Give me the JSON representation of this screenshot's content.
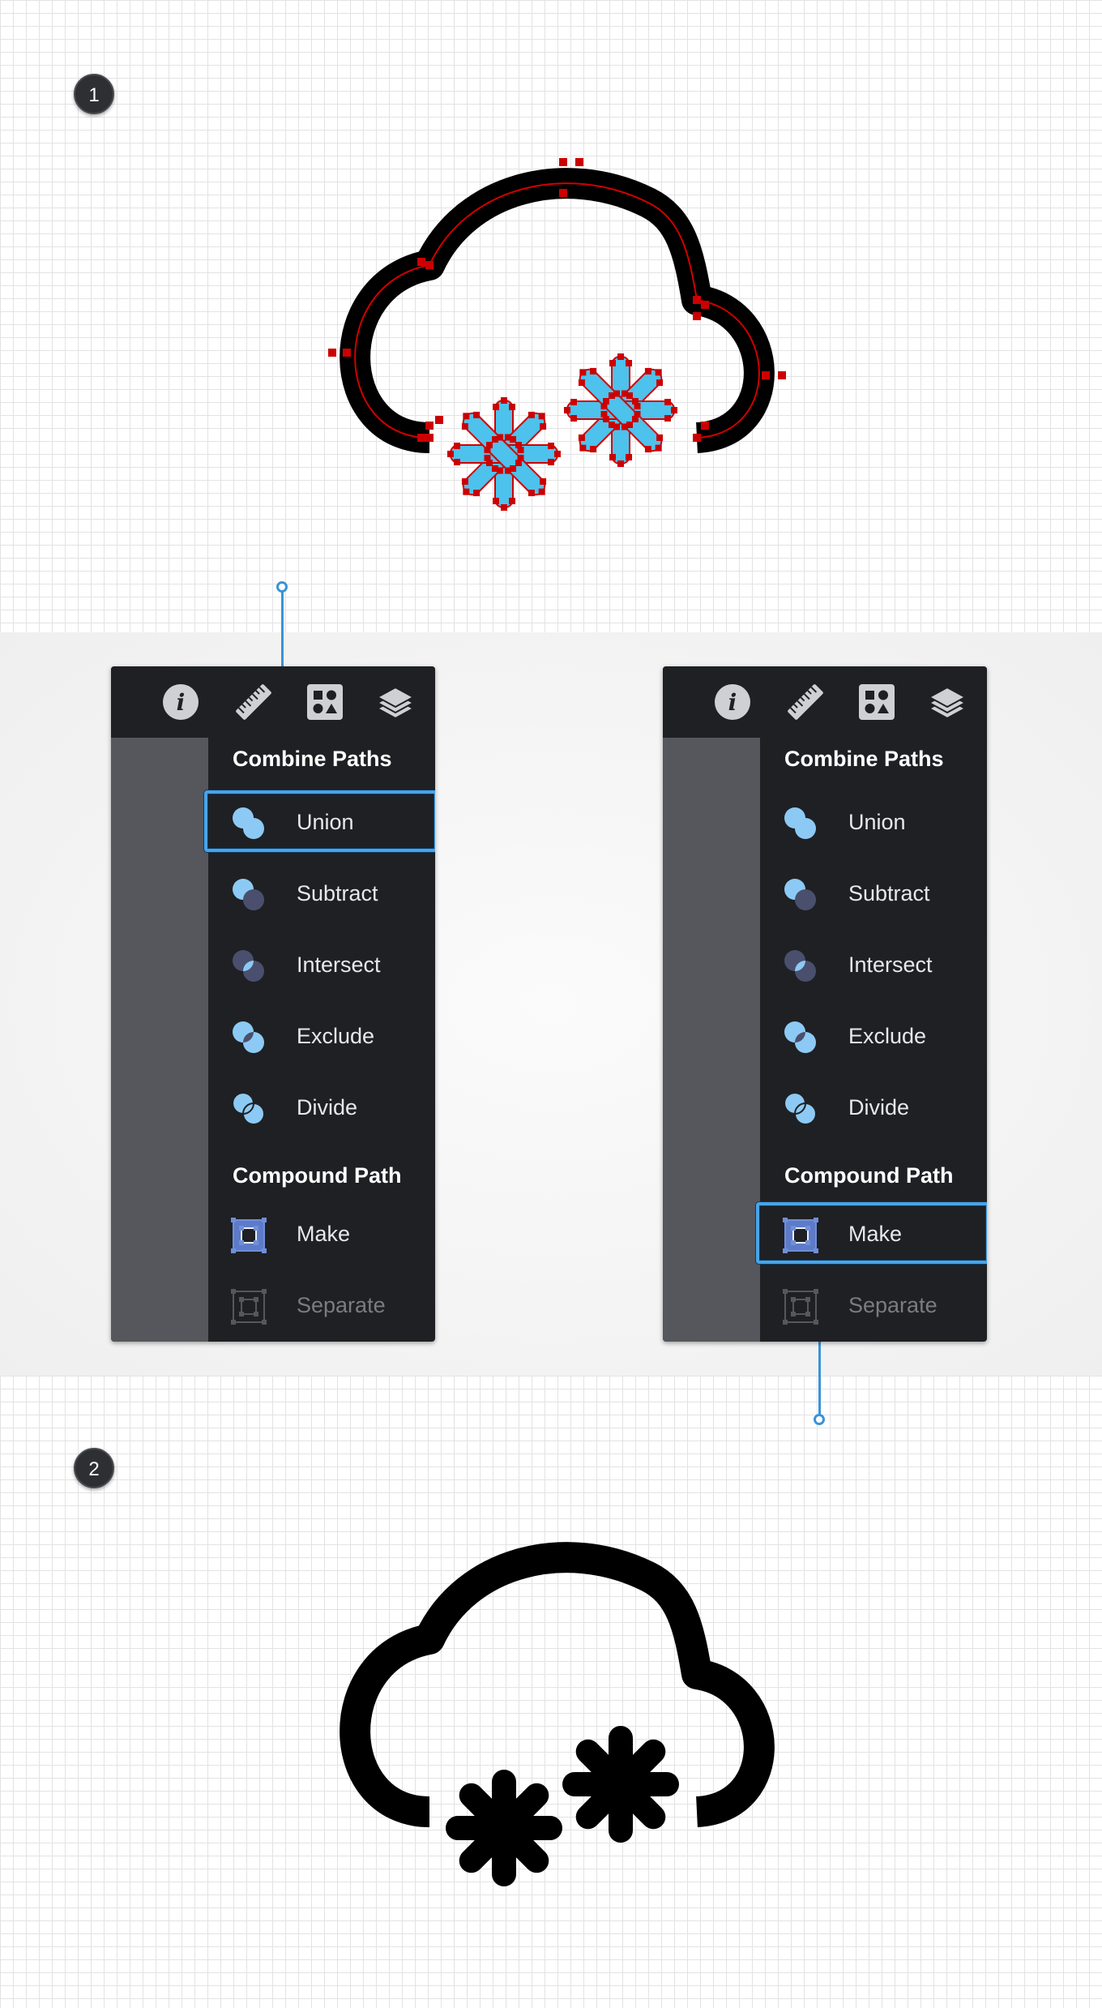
{
  "steps": {
    "first": "1",
    "second": "2"
  },
  "panels": [
    {
      "toolbar_icons": [
        "info-icon",
        "ruler-icon",
        "shapes-icon",
        "layers-icon"
      ],
      "section_combine": "Combine Paths",
      "section_compound": "Compound Path",
      "items": [
        {
          "label": "Union",
          "icon": "union-icon",
          "selected": true
        },
        {
          "label": "Subtract",
          "icon": "subtract-icon"
        },
        {
          "label": "Intersect",
          "icon": "intersect-icon"
        },
        {
          "label": "Exclude",
          "icon": "exclude-icon"
        },
        {
          "label": "Divide",
          "icon": "divide-icon"
        },
        {
          "label": "Make",
          "icon": "make-compound-icon"
        },
        {
          "label": "Separate",
          "icon": "separate-compound-icon",
          "disabled": true
        }
      ]
    },
    {
      "toolbar_icons": [
        "info-icon",
        "ruler-icon",
        "shapes-icon",
        "layers-icon"
      ],
      "section_combine": "Combine Paths",
      "section_compound": "Compound Path",
      "items": [
        {
          "label": "Union",
          "icon": "union-icon"
        },
        {
          "label": "Subtract",
          "icon": "subtract-icon"
        },
        {
          "label": "Intersect",
          "icon": "intersect-icon"
        },
        {
          "label": "Exclude",
          "icon": "exclude-icon"
        },
        {
          "label": "Divide",
          "icon": "divide-icon"
        },
        {
          "label": "Make",
          "icon": "make-compound-icon",
          "selected": true
        },
        {
          "label": "Separate",
          "icon": "separate-compound-icon",
          "disabled": true
        }
      ]
    }
  ],
  "colors": {
    "panel_bg": "#1f2023",
    "sidebar": "#55575c",
    "highlight": "#4aa3e8",
    "snowflake_fill": "#4cc2ec",
    "anchor_points": "#cc0000",
    "artwork": "#000000"
  }
}
